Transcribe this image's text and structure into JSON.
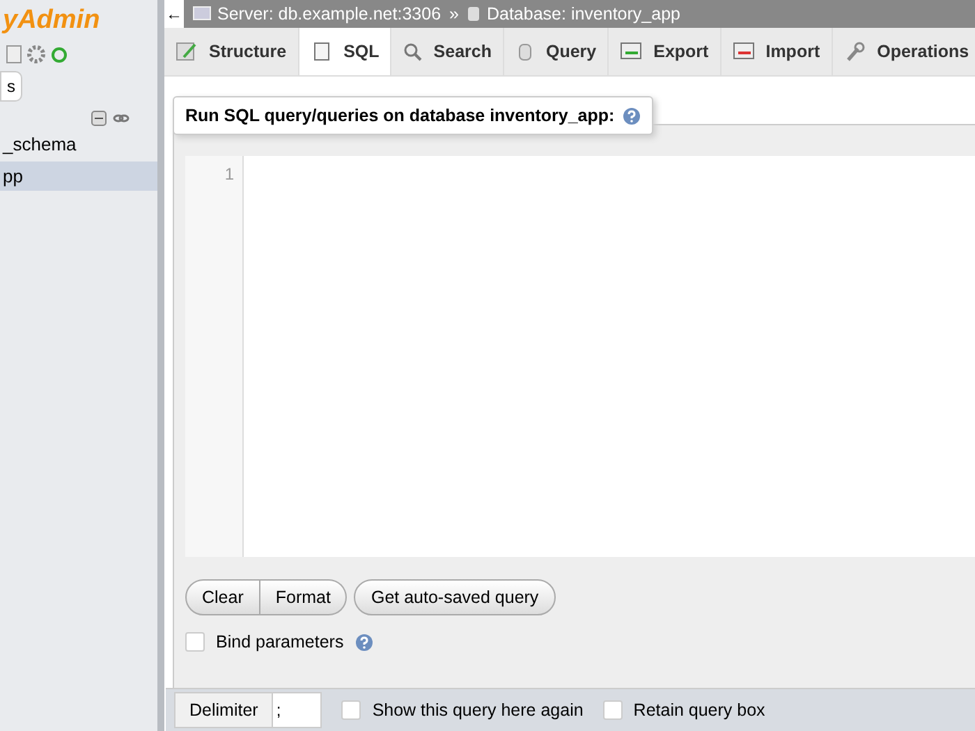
{
  "sidebar": {
    "logo": "yAdmin",
    "button": "s",
    "databases": [
      {
        "name": "_schema",
        "selected": false
      },
      {
        "name": "pp",
        "selected": true
      }
    ]
  },
  "breadcrumb": {
    "back": "←",
    "server": "Server: db.example.net:3306",
    "separator": "»",
    "database": "Database: inventory_app"
  },
  "tabs": [
    {
      "label": "Structure",
      "selected": false
    },
    {
      "label": "SQL",
      "selected": true
    },
    {
      "label": "Search",
      "selected": false
    },
    {
      "label": "Query",
      "selected": false
    },
    {
      "label": "Export",
      "selected": false
    },
    {
      "label": "Import",
      "selected": false
    },
    {
      "label": "Operations",
      "selected": false
    }
  ],
  "query_panel": {
    "legend": "Run SQL query/queries on database **inventory_app**:",
    "line_numbers": [
      "1"
    ],
    "buttons": [
      "Clear",
      "Format"
    ],
    "autosave_button": "Get auto-saved query",
    "bind_parameters": {
      "label": "Bind parameters",
      "checked": false
    }
  },
  "footer": {
    "delimiter_label": "Delimiter",
    "delimiter_value": ";",
    "options": [
      {
        "label": "Show this query here again",
        "checked": false
      },
      {
        "label": "Retain query box",
        "checked": false
      }
    ]
  }
}
